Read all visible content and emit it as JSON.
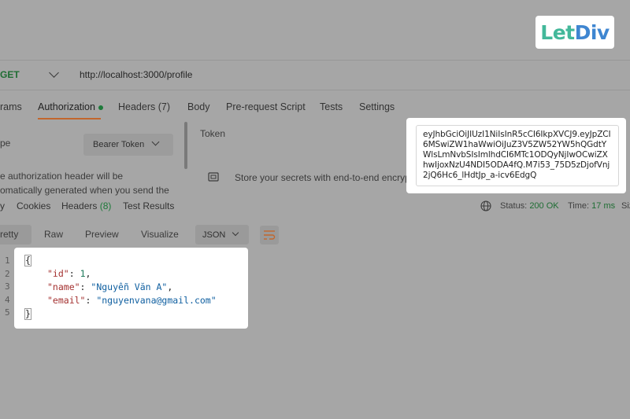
{
  "logo": {
    "part1": "Let",
    "part2": "Div"
  },
  "request": {
    "method": "GET",
    "url": "http://localhost:3000/profile",
    "tabs": [
      {
        "label": "rams"
      },
      {
        "label": "Authorization"
      },
      {
        "label": "Headers (7)"
      },
      {
        "label": "Body"
      },
      {
        "label": "Pre-request Script"
      },
      {
        "label": "Tests"
      },
      {
        "label": "Settings"
      }
    ]
  },
  "auth": {
    "type_label": "pe",
    "type_value": "Bearer Token",
    "description_line1": "e authorization header will be",
    "description_line2": "omatically generated when you send the",
    "token_label": "Token",
    "secrets_hint": "Store your secrets with end-to-end encrypt",
    "token_value": "eyJhbGciOiJIUzI1NiIsInR5cCI6IkpXVCJ9.eyJpZCI6MSwiZW1haWwiOiJuZ3V5ZW52YW5hQGdtYWlsLmNvbSIsImlhdCI6MTc1ODQyNjIwOCwiZXhwIjoxNzU4NDI5ODA4fQ.M7i53_75D5zDjofVnj2jQ6Hc6_lHdtJp_a-icv6EdgQ"
  },
  "response": {
    "tabs": [
      {
        "label": "y"
      },
      {
        "label": "Cookies"
      },
      {
        "label": "Headers",
        "count": "(8)"
      },
      {
        "label": "Test Results"
      }
    ],
    "status_label": "Status:",
    "status_value": "200 OK",
    "time_label": "Time:",
    "time_value": "17 ms",
    "size_label": "Siz",
    "view_tabs": [
      "retty",
      "Raw",
      "Preview",
      "Visualize"
    ],
    "format": "JSON",
    "line_numbers": [
      "1",
      "2",
      "3",
      "4",
      "5"
    ],
    "body": {
      "open": "{",
      "close": "}",
      "id_key": "\"id\"",
      "id_value": "1",
      "name_key": "\"name\"",
      "name_value": "\"Nguyễn Văn A\"",
      "email_key": "\"email\"",
      "email_value": "\"nguyenvana@gmail.com\""
    }
  },
  "colors": {
    "background": "#a6a6a6",
    "method_green": "#1f6d33",
    "active_tab_accent": "#c2662d",
    "logo_green": "#43b89a",
    "logo_blue": "#3f86d1"
  }
}
